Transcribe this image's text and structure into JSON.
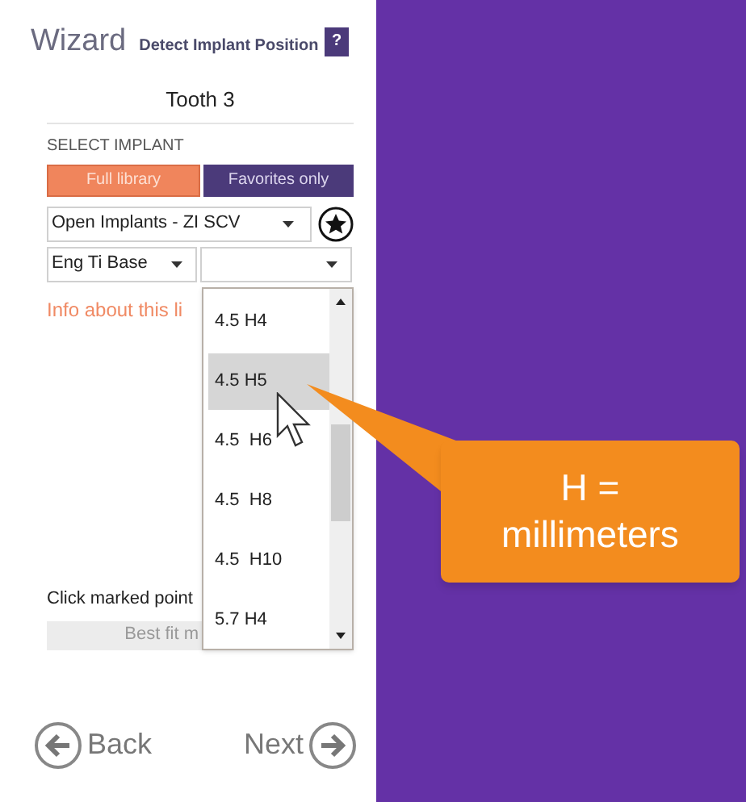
{
  "header": {
    "title": "Wizard",
    "subtitle": "Detect Implant Position",
    "help": "?"
  },
  "tooth": "Tooth 3",
  "section_label": "SELECT IMPLANT",
  "tabs": [
    {
      "label": "Full library",
      "selected": true
    },
    {
      "label": "Favorites only",
      "selected": false
    }
  ],
  "library_select": {
    "value": "Open Implants - ZI SCV"
  },
  "abutment_select": {
    "value": "Eng Ti Base"
  },
  "info_text": "Info about this li",
  "instruction": "Click marked point",
  "best_fit_button": "Best fit m",
  "size_options": [
    {
      "label": "4.5 H4",
      "selected": false
    },
    {
      "label": "4.5 H5",
      "selected": true
    },
    {
      "label": "4.5  H6",
      "selected": false
    },
    {
      "label": "4.5  H8",
      "selected": false
    },
    {
      "label": "4.5  H10",
      "selected": false
    },
    {
      "label": "5.7 H4",
      "selected": false
    }
  ],
  "nav": {
    "back": "Back",
    "next": "Next"
  },
  "callout": "H = millimeters"
}
